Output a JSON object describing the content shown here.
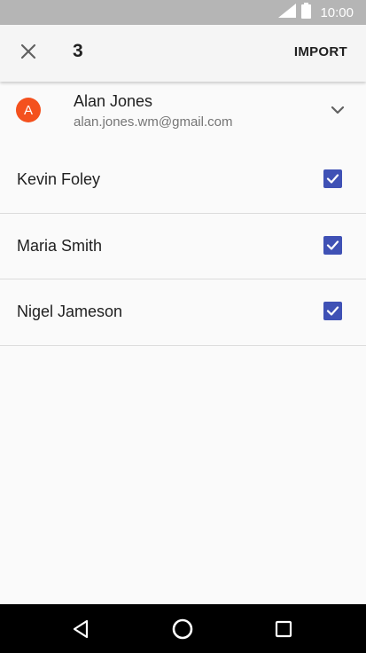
{
  "status_bar": {
    "time": "10:00",
    "icons": [
      "signal-icon",
      "battery-icon"
    ]
  },
  "toolbar": {
    "close_icon": "close-icon",
    "count": "3",
    "import_label": "IMPORT"
  },
  "account": {
    "avatar_letter": "A",
    "avatar_color": "#f4511e",
    "name": "Alan Jones",
    "email": "alan.jones.wm@gmail.com",
    "expand_icon": "chevron-down-icon"
  },
  "contacts": [
    {
      "name": "Kevin Foley",
      "checked": true
    },
    {
      "name": "Maria Smith",
      "checked": true
    },
    {
      "name": "Nigel Jameson",
      "checked": true
    }
  ],
  "colors": {
    "accent": "#3f51b5",
    "status_bar": "#b5b5b5",
    "nav_bar": "#000000"
  },
  "nav_bar": {
    "buttons": [
      "back-icon",
      "home-icon",
      "recents-icon"
    ]
  }
}
